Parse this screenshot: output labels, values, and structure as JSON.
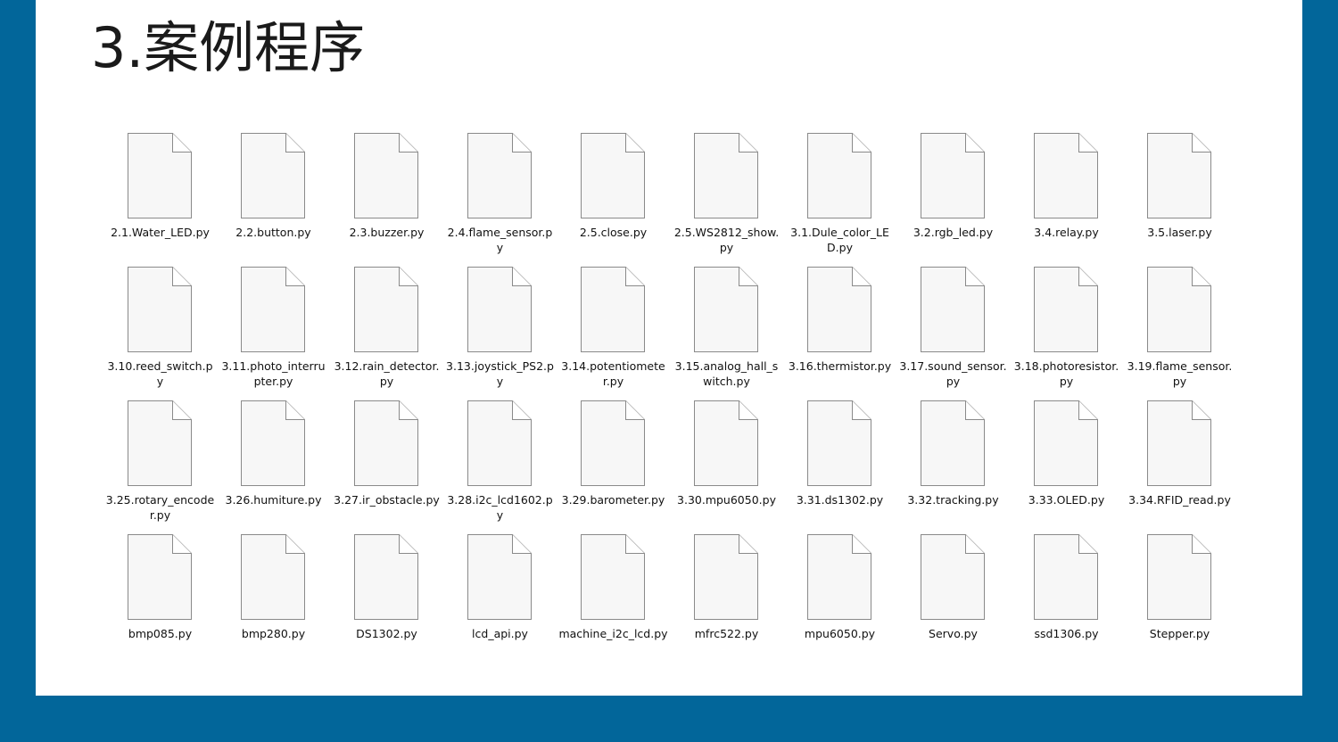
{
  "page": {
    "title": "3.案例程序",
    "background_color": "#02669a",
    "panel_color": "#ffffff"
  },
  "files": [
    {
      "name": "2.1.Water_LED.py",
      "icon": "document-icon"
    },
    {
      "name": "2.2.button.py",
      "icon": "document-icon"
    },
    {
      "name": "2.3.buzzer.py",
      "icon": "document-icon"
    },
    {
      "name": "2.4.flame_sensor.py",
      "icon": "document-icon"
    },
    {
      "name": "2.5.close.py",
      "icon": "document-icon"
    },
    {
      "name": "2.5.WS2812_show.py",
      "icon": "document-icon"
    },
    {
      "name": "3.1.Dule_color_LED.py",
      "icon": "document-icon"
    },
    {
      "name": "3.2.rgb_led.py",
      "icon": "document-icon"
    },
    {
      "name": "3.4.relay.py",
      "icon": "document-icon"
    },
    {
      "name": "3.5.laser.py",
      "icon": "document-icon"
    },
    {
      "name": "3.10.reed_switch.py",
      "icon": "document-icon"
    },
    {
      "name": "3.11.photo_interrupter.py",
      "icon": "document-icon"
    },
    {
      "name": "3.12.rain_detector.py",
      "icon": "document-icon"
    },
    {
      "name": "3.13.joystick_PS2.py",
      "icon": "document-icon"
    },
    {
      "name": "3.14.potentiometer.py",
      "icon": "document-icon"
    },
    {
      "name": "3.15.analog_hall_switch.py",
      "icon": "document-icon"
    },
    {
      "name": "3.16.thermistor.py",
      "icon": "document-icon"
    },
    {
      "name": "3.17.sound_sensor.py",
      "icon": "document-icon"
    },
    {
      "name": "3.18.photoresistor.py",
      "icon": "document-icon"
    },
    {
      "name": "3.19.flame_sensor.py",
      "icon": "document-icon"
    },
    {
      "name": "3.25.rotary_encoder.py",
      "icon": "document-icon"
    },
    {
      "name": "3.26.humiture.py",
      "icon": "document-icon"
    },
    {
      "name": "3.27.ir_obstacle.py",
      "icon": "document-icon"
    },
    {
      "name": "3.28.i2c_lcd1602.py",
      "icon": "document-icon"
    },
    {
      "name": "3.29.barometer.py",
      "icon": "document-icon"
    },
    {
      "name": "3.30.mpu6050.py",
      "icon": "document-icon"
    },
    {
      "name": "3.31.ds1302.py",
      "icon": "document-icon"
    },
    {
      "name": "3.32.tracking.py",
      "icon": "document-icon"
    },
    {
      "name": "3.33.OLED.py",
      "icon": "document-icon"
    },
    {
      "name": "3.34.RFID_read.py",
      "icon": "document-icon"
    },
    {
      "name": "bmp085.py",
      "icon": "document-icon"
    },
    {
      "name": "bmp280.py",
      "icon": "document-icon"
    },
    {
      "name": "DS1302.py",
      "icon": "document-icon"
    },
    {
      "name": "lcd_api.py",
      "icon": "document-icon"
    },
    {
      "name": "machine_i2c_lcd.py",
      "icon": "document-icon"
    },
    {
      "name": "mfrc522.py",
      "icon": "document-icon"
    },
    {
      "name": "mpu6050.py",
      "icon": "document-icon"
    },
    {
      "name": "Servo.py",
      "icon": "document-icon"
    },
    {
      "name": "ssd1306.py",
      "icon": "document-icon"
    },
    {
      "name": "Stepper.py",
      "icon": "document-icon"
    }
  ]
}
